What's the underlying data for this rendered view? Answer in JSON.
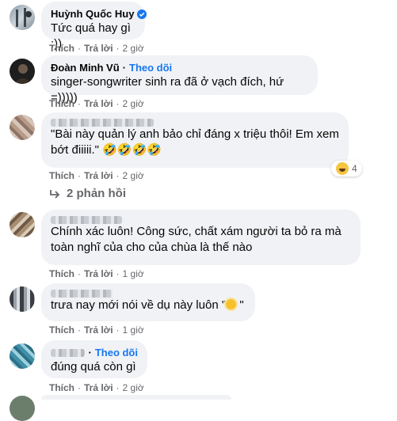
{
  "comments": [
    {
      "author": "Huỳnh Quốc Huy",
      "text": "Tức quá hay gì :))",
      "like": "Thích",
      "reply": "Trả lời",
      "time": "2 giờ"
    },
    {
      "author": "Đoàn Minh Vũ",
      "follow": "Theo dõi",
      "text": "singer-songwriter sinh ra đã ở vạch đích, hứ =)))))",
      "like": "Thích",
      "reply": "Trả lời",
      "time": "2 giờ"
    },
    {
      "text": "\"Bài này quản lý anh bảo chỉ đáng x triệu thôi! Em xem\nbớt điiiii.\" 🤣🤣🤣🤣",
      "reaction_count": "4",
      "like": "Thích",
      "reply": "Trả lời",
      "time": "2 giờ",
      "replies": "2 phản hồi"
    },
    {
      "text": "Chính xác luôn! Công sức, chất xám người ta bỏ ra mà\ntoàn nghĩ của cho của chùa là thế nào",
      "like": "Thích",
      "reply": "Trả lời",
      "time": "1 giờ"
    },
    {
      "text_a": "trưa nay mới nói về dụ này luôn \"",
      "text_b": " \"",
      "like": "Thích",
      "reply": "Trả lời",
      "time": "1 giờ"
    },
    {
      "follow": "Theo dõi",
      "text": "đúng quá còn gì",
      "like": "Thích",
      "reply": "Trả lời",
      "time": "2 giờ"
    }
  ],
  "colors": {
    "bubble": "#f0f2f5",
    "link": "#1877f2",
    "meta": "#65676b"
  }
}
